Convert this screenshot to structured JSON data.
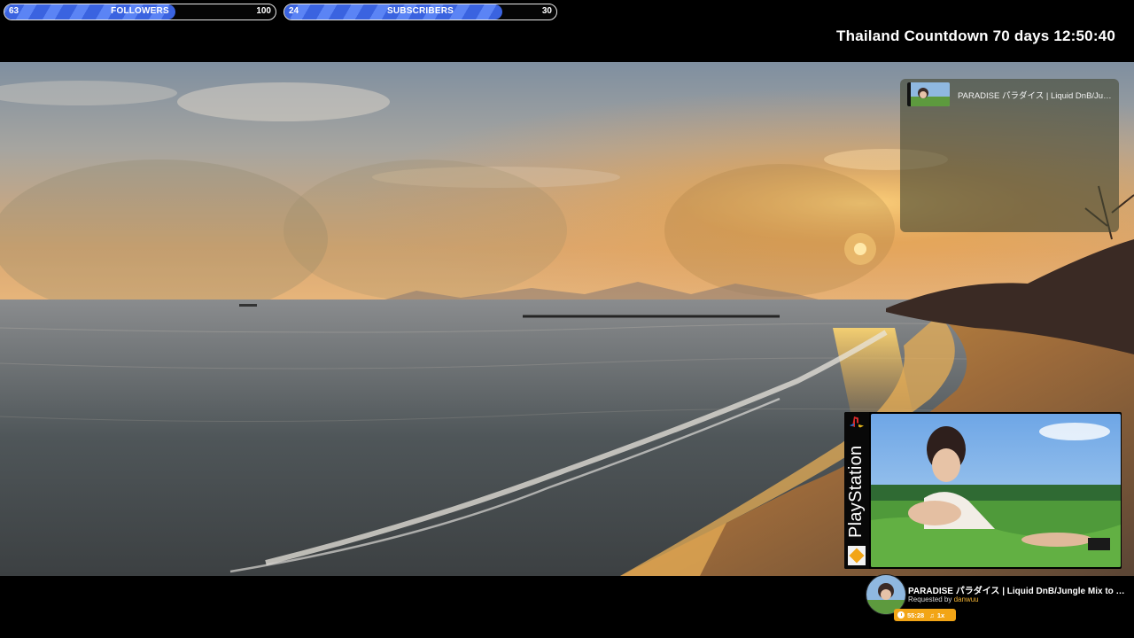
{
  "goals": [
    {
      "id": "followers",
      "label": "FOLLOWERS",
      "current": "63",
      "target": "100",
      "progress": 0.63
    },
    {
      "id": "subscribers",
      "label": "SUBSCRIBERS",
      "current": "24",
      "target": "30",
      "progress": 0.8
    }
  ],
  "countdown": {
    "text": "Thailand Countdown 70 days 12:50:40"
  },
  "now_playing": {
    "title": "PARADISE パラダイス | Liquid DnB/Jungle Mix to Relax"
  },
  "ps_case": {
    "brand": "PlayStation"
  },
  "song_request": {
    "title": "PARADISE パラダイス | Liquid DnB/Jungle Mix to Relax",
    "requested_prefix": "Requested by",
    "requester": "danwuu",
    "duration": "55:28",
    "queue": "1x"
  },
  "colors": {
    "goal_fill": "#4a73ec",
    "pill": "#f2a516",
    "requester": "#f2b233"
  }
}
